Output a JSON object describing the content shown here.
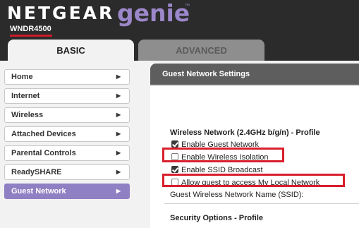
{
  "brand": {
    "name": "NETGEAR",
    "product": "genie",
    "trademark": "™",
    "model": "WNDR4500"
  },
  "tabs": [
    {
      "label": "BASIC",
      "active": true
    },
    {
      "label": "ADVANCED",
      "active": false
    }
  ],
  "sidebar": {
    "arrow_glyph": "▶",
    "items": [
      {
        "label": "Home"
      },
      {
        "label": "Internet"
      },
      {
        "label": "Wireless"
      },
      {
        "label": "Attached Devices"
      },
      {
        "label": "Parental Controls"
      },
      {
        "label": "ReadySHARE"
      },
      {
        "label": "Guest Network",
        "active": true
      }
    ]
  },
  "main": {
    "title": "Guest Network Settings",
    "profile_title": "Wireless Network (2.4GHz b/g/n) - Profile",
    "options": [
      {
        "label": "Enable Guest Network",
        "checked": true
      },
      {
        "label": "Enable Wireless Isolation",
        "checked": false,
        "highlighted": true
      },
      {
        "label": "Enable SSID Broadcast",
        "checked": true
      },
      {
        "label": "Allow guest to access My Local Network",
        "checked": false,
        "highlighted": true
      }
    ],
    "ssid_label": "Guest Wireless Network Name (SSID):",
    "security_title": "Security Options - Profile"
  },
  "colors": {
    "accent_purple": "#8f7fc3",
    "header_bg": "#2b2b2b",
    "highlight_red": "#d81f2c",
    "brand_red": "#cc1b2a"
  }
}
